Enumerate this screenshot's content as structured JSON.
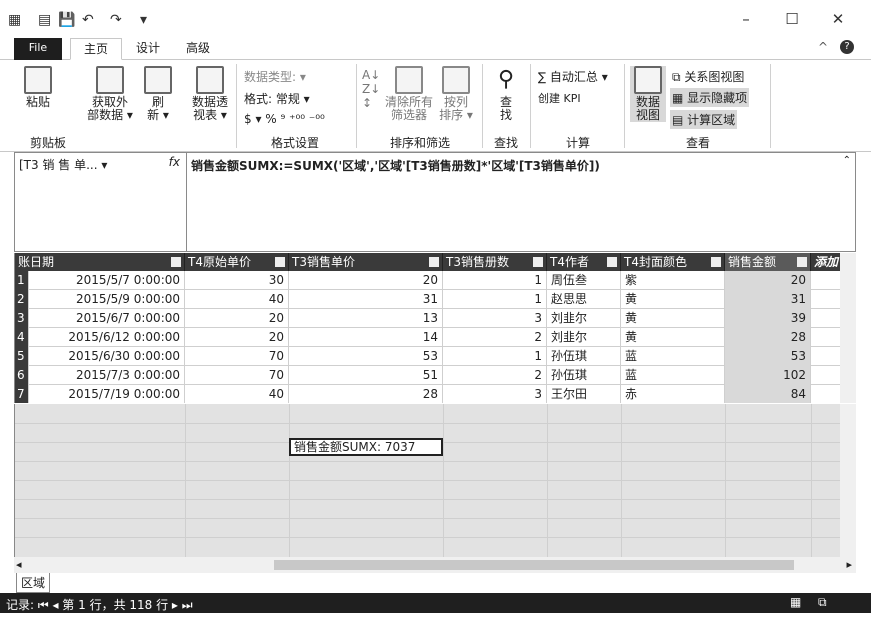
{
  "titlebar": {
    "minimize": "–",
    "maximize": "☐",
    "close": "✕",
    "collapse": "^"
  },
  "tabs": {
    "file": "File",
    "home": "主页",
    "design": "设计",
    "advanced": "高级"
  },
  "ribbon": {
    "paste": "粘贴",
    "get_external": [
      "获取外",
      "部数据 ▾"
    ],
    "refresh": [
      "刷",
      "新 ▾"
    ],
    "pivot": [
      "数据透",
      "视表 ▾"
    ],
    "data_type": "数据类型: ▾",
    "format": "格式: 常规 ▾",
    "numfmt": "$ ▾ % ⁹ ⁺⁰⁰ ⁻⁰⁰",
    "clear_filters": [
      "清除所有",
      "筛选器"
    ],
    "sort_by_col": [
      "按列",
      "排序 ▾"
    ],
    "find": [
      "查",
      "找"
    ],
    "autosum": "∑ 自动汇总 ▾",
    "create_kpi": "创建 KPI",
    "data_view": [
      "数据",
      "视图"
    ],
    "diagram_view": "关系图视图",
    "show_hidden": "显示隐藏项",
    "calc_area": "计算区域",
    "groups": {
      "clipboard": "剪贴板",
      "format": "格式设置",
      "sort_filter": "排序和筛选",
      "find": "查找",
      "calc": "计算",
      "view": "查看"
    }
  },
  "formula_bar": {
    "name": "[T3 销 售 单... ▾",
    "fx": "fx",
    "formula": "销售金额SUMX:=SUMX('区域','区域'[T3销售册数]*'区域'[T3销售单价])"
  },
  "grid": {
    "headers": [
      "账日期",
      "T4原始单价",
      "T3销售单价",
      "T3销售册数",
      "T4作者",
      "T4封面颜色",
      "销售金额",
      "添加"
    ],
    "rows": [
      [
        "1",
        "2015/5/7 0:00:00",
        "30",
        "20",
        "1",
        "周伍叁",
        "紫",
        "20"
      ],
      [
        "2",
        "2015/5/9 0:00:00",
        "40",
        "31",
        "1",
        "赵思思",
        "黄",
        "31"
      ],
      [
        "3",
        "2015/6/7 0:00:00",
        "20",
        "13",
        "3",
        "刘韭尔",
        "黄",
        "39"
      ],
      [
        "4",
        "2015/6/12 0:00:00",
        "20",
        "14",
        "2",
        "刘韭尔",
        "黄",
        "28"
      ],
      [
        "5",
        "2015/6/30 0:00:00",
        "70",
        "53",
        "1",
        "孙伍琪",
        "蓝",
        "53"
      ],
      [
        "6",
        "2015/7/3 0:00:00",
        "70",
        "51",
        "2",
        "孙伍琪",
        "蓝",
        "102"
      ],
      [
        "7",
        "2015/7/19 0:00:00",
        "40",
        "28",
        "3",
        "王尔田",
        "赤",
        "84"
      ]
    ]
  },
  "measure": "销售金额SUMX: 7037",
  "sheet_tab": "区域",
  "status": {
    "record": "记录:  ⏮  ◂  第 1 行，共 118 行  ▸  ⏭"
  }
}
